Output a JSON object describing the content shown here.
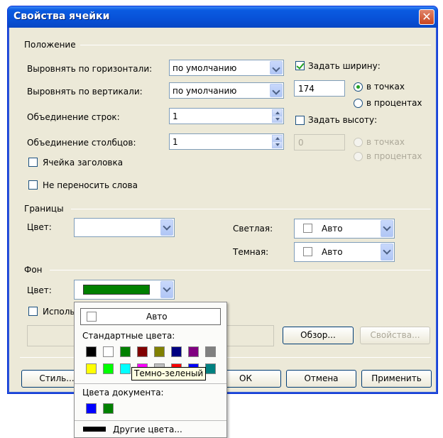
{
  "dialog": {
    "title": "Свойства ячейки",
    "close_label": "✕"
  },
  "position": {
    "group_label": "Положение",
    "h_align_label": "Выровнять по горизонтали:",
    "h_align_value": "по умолчанию",
    "v_align_label": "Выровнять по вертикали:",
    "v_align_value": "по умолчанию",
    "row_span_label": "Объединение строк:",
    "row_span_value": "1",
    "col_span_label": "Объединение столбцов:",
    "col_span_value": "1",
    "header_cell_label": "Ячейка заголовка",
    "nowrap_label": "Не переносить слова",
    "set_width_label": "Задать ширину:",
    "width_value": "174",
    "width_points_label": "в точках",
    "width_percent_label": "в процентах",
    "set_height_label": "Задать высоту:",
    "height_value": "0",
    "height_points_label": "в точках",
    "height_percent_label": "в процентах"
  },
  "borders": {
    "group_label": "Границы",
    "color_label": "Цвет:",
    "light_label": "Светлая:",
    "light_value": "Авто",
    "dark_label": "Темная:",
    "dark_value": "Авто"
  },
  "background": {
    "group_label": "Фон",
    "color_label": "Цвет:",
    "color_value": "#008000",
    "use_image_label": "Исполь",
    "browse_label": "Обзор...",
    "properties_label": "Свойства..."
  },
  "footer": {
    "style_label": "Стиль...",
    "ok_label": "ОК",
    "cancel_label": "Отмена",
    "apply_label": "Применить"
  },
  "color_menu": {
    "auto_label": "Авто",
    "standard_label": "Стандартные цвета:",
    "standard_colors": [
      "#000000",
      "#ffffff",
      "#008000",
      "#800000",
      "#808000",
      "#000080",
      "#800080",
      "#808080",
      "#ffff00",
      "#00ff00",
      "#00ffff",
      "#ff00ff",
      "#c0c0c0",
      "#ff0000",
      "#0000ff",
      "#008080"
    ],
    "document_label": "Цвета документа:",
    "document_colors": [
      "#0000ff",
      "#008000"
    ],
    "more_label": "Другие цвета...",
    "tooltip": "Темно-зеленый"
  }
}
